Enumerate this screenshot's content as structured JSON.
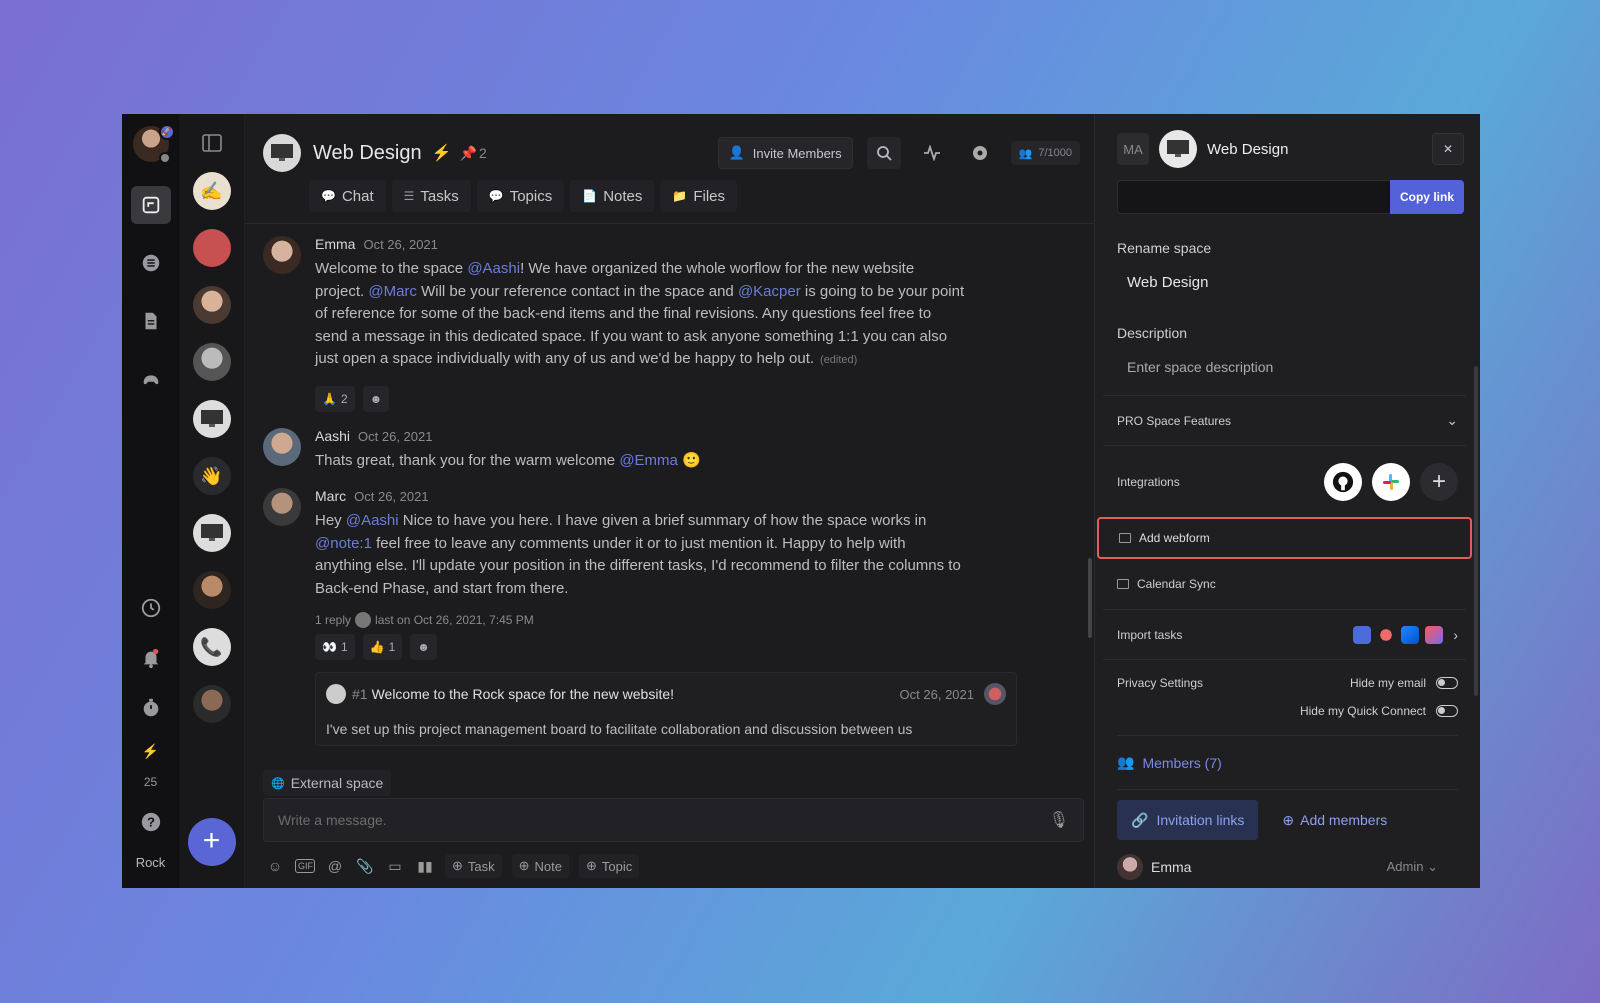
{
  "rail": {
    "count": "25",
    "workspace": "Rock"
  },
  "header": {
    "title": "Web Design",
    "pin_count": "2",
    "invite_label": "Invite Members",
    "members_count": "7/1000"
  },
  "tabs": [
    {
      "label": "Chat"
    },
    {
      "label": "Tasks"
    },
    {
      "label": "Topics"
    },
    {
      "label": "Notes"
    },
    {
      "label": "Files"
    }
  ],
  "messages": [
    {
      "name": "Emma",
      "date": "Oct 26, 2021",
      "p1": "Welcome to the space ",
      "m1": "@Aashi",
      "p2": "! We have organized the whole worflow for the new website project. ",
      "m2": "@Marc",
      "p3": " Will be your reference contact in the space and ",
      "m3": "@Kacper",
      "p4": "  is going to be your point of reference for some of the back-end items and the final revisions. Any questions feel free to send a message in this dedicated space. If you want to ask anyone something 1:1 you can also just open a space individually with any of us and we'd be happy to help out.",
      "edited": "(edited)",
      "reaction_count": "2"
    },
    {
      "name": "Aashi",
      "date": "Oct 26, 2021",
      "p1": "Thats great, thank you for the warm welcome ",
      "m1": "@Emma"
    },
    {
      "name": "Marc",
      "date": "Oct 26, 2021",
      "p1": "Hey ",
      "m1": "@Aashi",
      "p2": " Nice to have you here. I have given a brief summary of how the space works in ",
      "m2": "@note:1",
      "p3": " feel free to leave any comments under it or to just mention it. Happy to help with anything else. I'll update your position in the different tasks, I'd recommend to filter the columns to Back-end Phase, and start from there.",
      "reply_prefix": "1 reply",
      "reply_suffix": "last on Oct 26, 2021, 7:45 PM",
      "react1": "1",
      "react2": "1"
    }
  ],
  "thread": {
    "num": "#1",
    "title": "Welcome to the Rock space for the new website!",
    "date": "Oct 26, 2021",
    "text": "I've set up this project management board to facilitate collaboration and discussion between us"
  },
  "composer": {
    "external": "External space",
    "placeholder": "Write a message.",
    "task": "Task",
    "note": "Note",
    "topic": "Topic"
  },
  "panel": {
    "ma": "MA",
    "title": "Web Design",
    "copy_link": "Copy link",
    "rename_label": "Rename space",
    "rename_value": "Web Design",
    "description_label": "Description",
    "description_placeholder": "Enter space description",
    "pro_features": "PRO Space Features",
    "integrations": "Integrations",
    "add_webform": "Add webform",
    "calendar_sync": "Calendar Sync",
    "import_tasks": "Import tasks",
    "privacy": "Privacy Settings",
    "hide_email": "Hide my email",
    "hide_quick": "Hide my Quick Connect",
    "members": "Members (7)",
    "invitation_links": "Invitation links",
    "add_members": "Add members",
    "member_name": "Emma",
    "member_role": "Admin"
  }
}
